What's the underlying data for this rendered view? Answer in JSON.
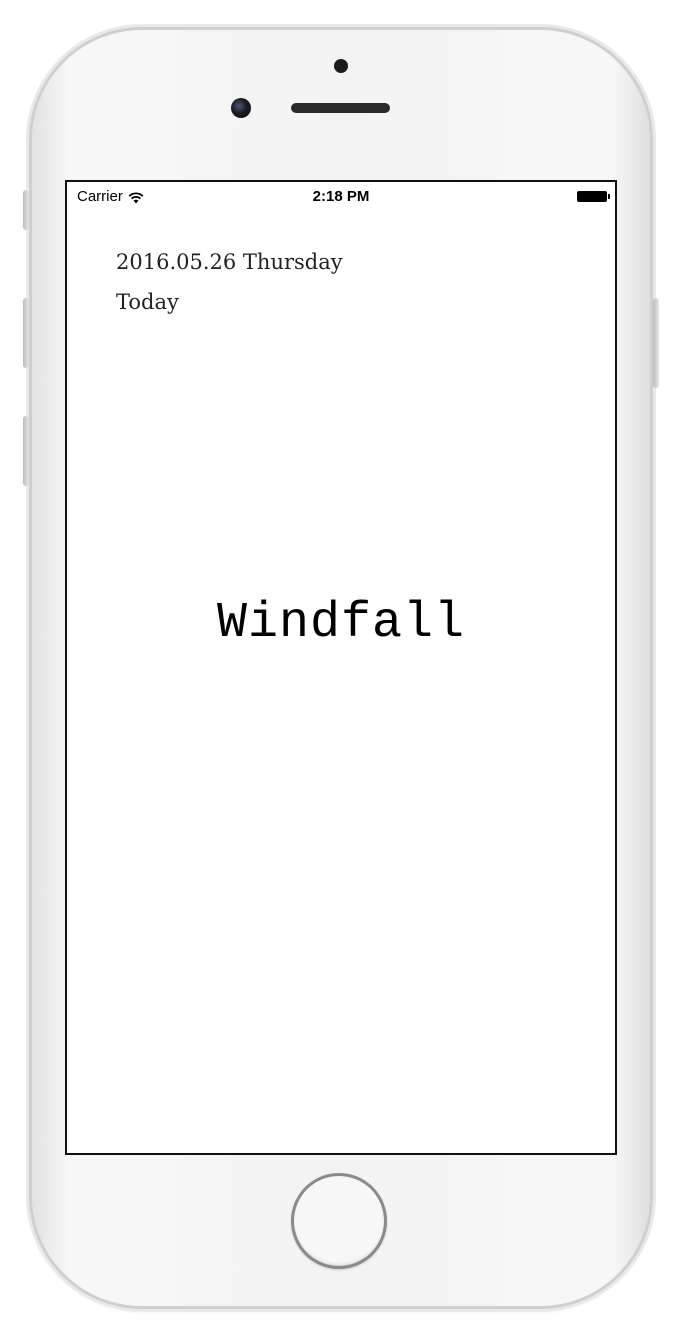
{
  "status_bar": {
    "carrier": "Carrier",
    "time": "2:18 PM",
    "wifi_icon": "wifi-icon",
    "battery_icon": "battery-icon"
  },
  "header": {
    "date": "2016.05.26 Thursday",
    "day_label": "Today"
  },
  "main": {
    "title": "Windfall"
  },
  "device": {
    "home_button_icon": "home-button-icon",
    "frame_color": "#f3f3f3",
    "screen_border_color": "#111111"
  }
}
